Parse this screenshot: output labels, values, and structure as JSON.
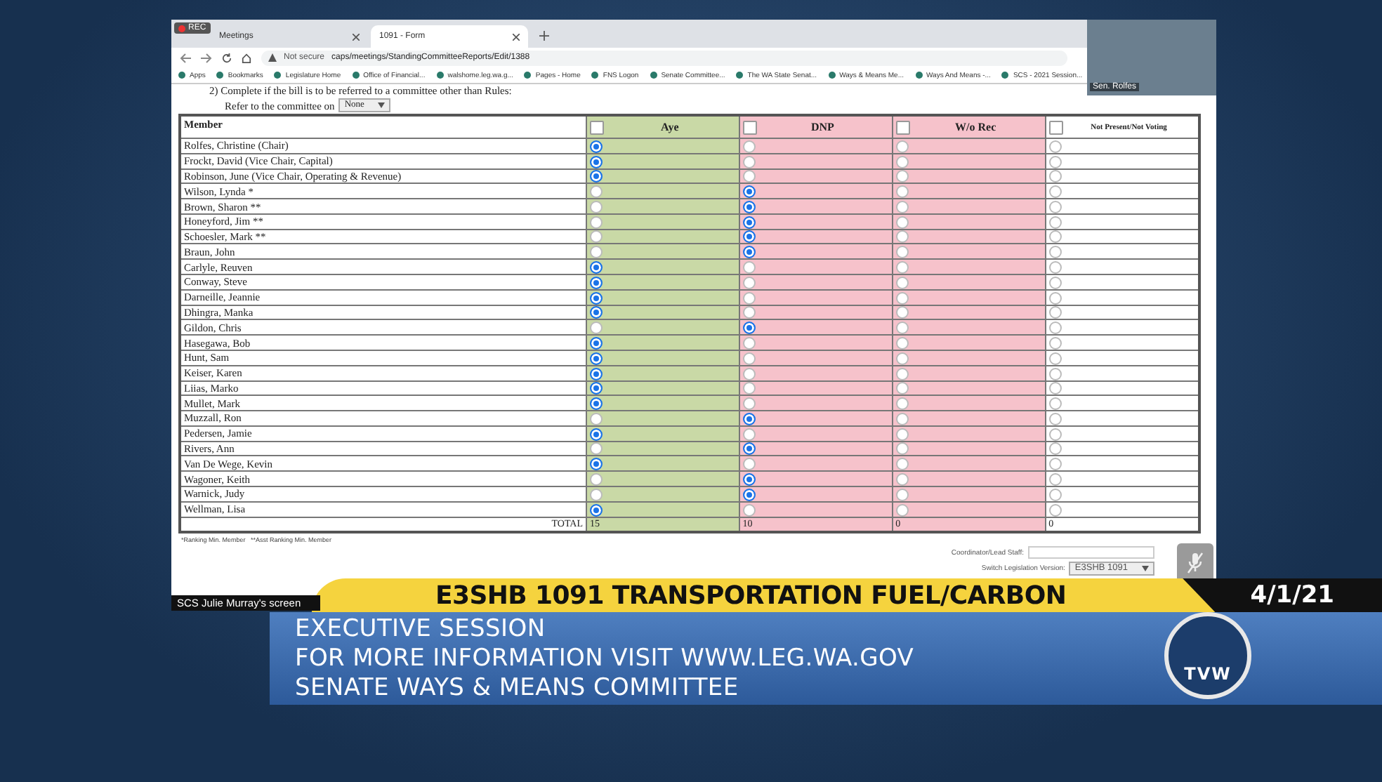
{
  "browser": {
    "rec_badge": "REC",
    "tabs": [
      {
        "label": "Meetings",
        "selected": false
      },
      {
        "label": "1091 - Form",
        "selected": true
      }
    ],
    "security": "Not secure",
    "url": "caps/meetings/StandingCommitteeReports/Edit/1388",
    "bookmarks": [
      "Apps",
      "Bookmarks",
      "Legislature Home",
      "Office of Financial...",
      "walshome.leg.wa.g...",
      "Pages - Home",
      "FNS Logon",
      "Senate Committee...",
      "The WA State Senat...",
      "Ways & Means Me...",
      "Ways And Means -...",
      "SCS - 2021 Session..."
    ]
  },
  "form": {
    "instruction": "2) Complete if the bill is to be referred to a committee other than Rules:",
    "refer_label": "Refer to the committee on",
    "refer_value": "None",
    "member_header": "Member",
    "columns": [
      {
        "label": "Aye",
        "checked": false,
        "color": "#c9d9a6"
      },
      {
        "label": "DNP",
        "checked": false,
        "color": "#f6c2cb"
      },
      {
        "label": "W/o Rec",
        "checked": false,
        "color": "#f6c2cb"
      },
      {
        "label": "Not Present/Not Voting",
        "checked": false,
        "color": "#ffffff"
      }
    ],
    "rows": [
      {
        "member": "Rolfes, Christine (Chair)",
        "votes": [
          {
            "selected": true
          },
          {
            "selected": false
          },
          {
            "selected": false
          },
          {
            "selected": false
          }
        ]
      },
      {
        "member": "Frockt, David (Vice Chair, Capital)",
        "votes": [
          {
            "selected": true
          },
          {
            "selected": false
          },
          {
            "selected": false
          },
          {
            "selected": false
          }
        ]
      },
      {
        "member": "Robinson, June (Vice Chair, Operating & Revenue)",
        "votes": [
          {
            "selected": true
          },
          {
            "selected": false
          },
          {
            "selected": false
          },
          {
            "selected": false
          }
        ]
      },
      {
        "member": "Wilson, Lynda *",
        "votes": [
          {
            "selected": false
          },
          {
            "selected": true
          },
          {
            "selected": false
          },
          {
            "selected": false
          }
        ]
      },
      {
        "member": "Brown, Sharon **",
        "votes": [
          {
            "selected": false
          },
          {
            "selected": true
          },
          {
            "selected": false
          },
          {
            "selected": false
          }
        ]
      },
      {
        "member": "Honeyford, Jim **",
        "votes": [
          {
            "selected": false
          },
          {
            "selected": true
          },
          {
            "selected": false
          },
          {
            "selected": false
          }
        ]
      },
      {
        "member": "Schoesler, Mark **",
        "votes": [
          {
            "selected": false
          },
          {
            "selected": true
          },
          {
            "selected": false
          },
          {
            "selected": false
          }
        ]
      },
      {
        "member": "Braun, John",
        "votes": [
          {
            "selected": false
          },
          {
            "selected": true
          },
          {
            "selected": false
          },
          {
            "selected": false
          }
        ]
      },
      {
        "member": "Carlyle, Reuven",
        "votes": [
          {
            "selected": true
          },
          {
            "selected": false
          },
          {
            "selected": false
          },
          {
            "selected": false
          }
        ]
      },
      {
        "member": "Conway, Steve",
        "votes": [
          {
            "selected": true
          },
          {
            "selected": false
          },
          {
            "selected": false
          },
          {
            "selected": false
          }
        ]
      },
      {
        "member": "Darneille, Jeannie",
        "votes": [
          {
            "selected": true
          },
          {
            "selected": false
          },
          {
            "selected": false
          },
          {
            "selected": false
          }
        ]
      },
      {
        "member": "Dhingra, Manka",
        "votes": [
          {
            "selected": true
          },
          {
            "selected": false
          },
          {
            "selected": false
          },
          {
            "selected": false
          }
        ]
      },
      {
        "member": "Gildon, Chris",
        "votes": [
          {
            "selected": false
          },
          {
            "selected": true
          },
          {
            "selected": false
          },
          {
            "selected": false
          }
        ]
      },
      {
        "member": "Hasegawa, Bob",
        "votes": [
          {
            "selected": true
          },
          {
            "selected": false
          },
          {
            "selected": false
          },
          {
            "selected": false
          }
        ]
      },
      {
        "member": "Hunt, Sam",
        "votes": [
          {
            "selected": true
          },
          {
            "selected": false
          },
          {
            "selected": false
          },
          {
            "selected": false
          }
        ]
      },
      {
        "member": "Keiser, Karen",
        "votes": [
          {
            "selected": true
          },
          {
            "selected": false
          },
          {
            "selected": false
          },
          {
            "selected": false
          }
        ]
      },
      {
        "member": "Liias, Marko",
        "votes": [
          {
            "selected": true
          },
          {
            "selected": false
          },
          {
            "selected": false
          },
          {
            "selected": false
          }
        ]
      },
      {
        "member": "Mullet, Mark",
        "votes": [
          {
            "selected": true
          },
          {
            "selected": false
          },
          {
            "selected": false
          },
          {
            "selected": false
          }
        ]
      },
      {
        "member": "Muzzall, Ron",
        "votes": [
          {
            "selected": false
          },
          {
            "selected": true
          },
          {
            "selected": false
          },
          {
            "selected": false
          }
        ]
      },
      {
        "member": "Pedersen, Jamie",
        "votes": [
          {
            "selected": true
          },
          {
            "selected": false
          },
          {
            "selected": false
          },
          {
            "selected": false
          }
        ]
      },
      {
        "member": "Rivers, Ann",
        "votes": [
          {
            "selected": false
          },
          {
            "selected": true
          },
          {
            "selected": false
          },
          {
            "selected": false
          }
        ]
      },
      {
        "member": "Van De Wege, Kevin",
        "votes": [
          {
            "selected": true
          },
          {
            "selected": false
          },
          {
            "selected": false
          },
          {
            "selected": false
          }
        ]
      },
      {
        "member": "Wagoner, Keith",
        "votes": [
          {
            "selected": false
          },
          {
            "selected": true
          },
          {
            "selected": false
          },
          {
            "selected": false
          }
        ]
      },
      {
        "member": "Warnick, Judy",
        "votes": [
          {
            "selected": false
          },
          {
            "selected": true
          },
          {
            "selected": false
          },
          {
            "selected": false
          }
        ]
      },
      {
        "member": "Wellman, Lisa",
        "votes": [
          {
            "selected": true
          },
          {
            "selected": false
          },
          {
            "selected": false
          },
          {
            "selected": false
          }
        ]
      }
    ],
    "total_label": "TOTAL",
    "totals": [
      "15",
      "10",
      "0",
      "0"
    ],
    "footnote": "*Ranking Min. Member   **Asst Ranking Min. Member",
    "coordinator_label": "Coordinator/Lead Staff:",
    "version_label": "Switch Legislation Version:",
    "version_value": "E3SHB 1091"
  },
  "video_tile": {
    "name": "Sen. Rolfes"
  },
  "screen_label": "SCS Julie Murray's screen",
  "broadcast": {
    "headline": "E3SHB 1091 TRANSPORTATION FUEL/CARBON",
    "date": "4/1/21",
    "lines": [
      "EXECUTIVE SESSION",
      "FOR MORE INFORMATION VISIT WWW.LEG.WA.GOV",
      "SENATE WAYS & MEANS COMMITTEE"
    ],
    "logo": "TVW"
  }
}
